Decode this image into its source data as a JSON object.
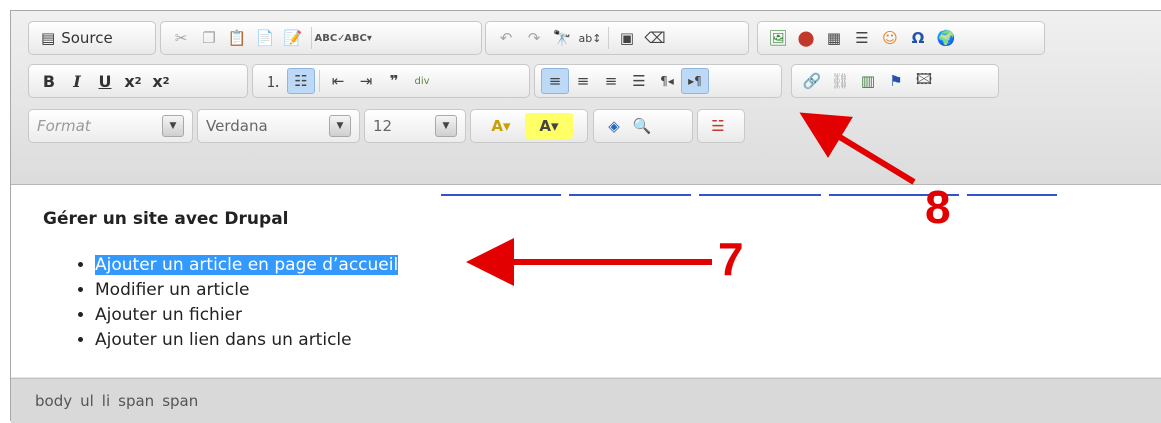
{
  "toolbar": {
    "source_label": "Source",
    "format_value": "Format",
    "font_value": "Verdana",
    "size_value": "12",
    "bold": "B",
    "italic": "I",
    "underline": "U"
  },
  "content": {
    "heading": "Gérer un site avec Drupal",
    "items": [
      "Ajouter un article en page d’accueil",
      "Modifier un article",
      "Ajouter un fichier",
      "Ajouter un lien dans un article"
    ]
  },
  "status": {
    "path": [
      "body",
      "ul",
      "li",
      "span",
      "span"
    ]
  },
  "annotations": {
    "label7": "7",
    "label8": "8",
    "color": "#e20000"
  },
  "colors": {
    "selection": "#3399ff",
    "active_button": "#bdd9f6"
  }
}
